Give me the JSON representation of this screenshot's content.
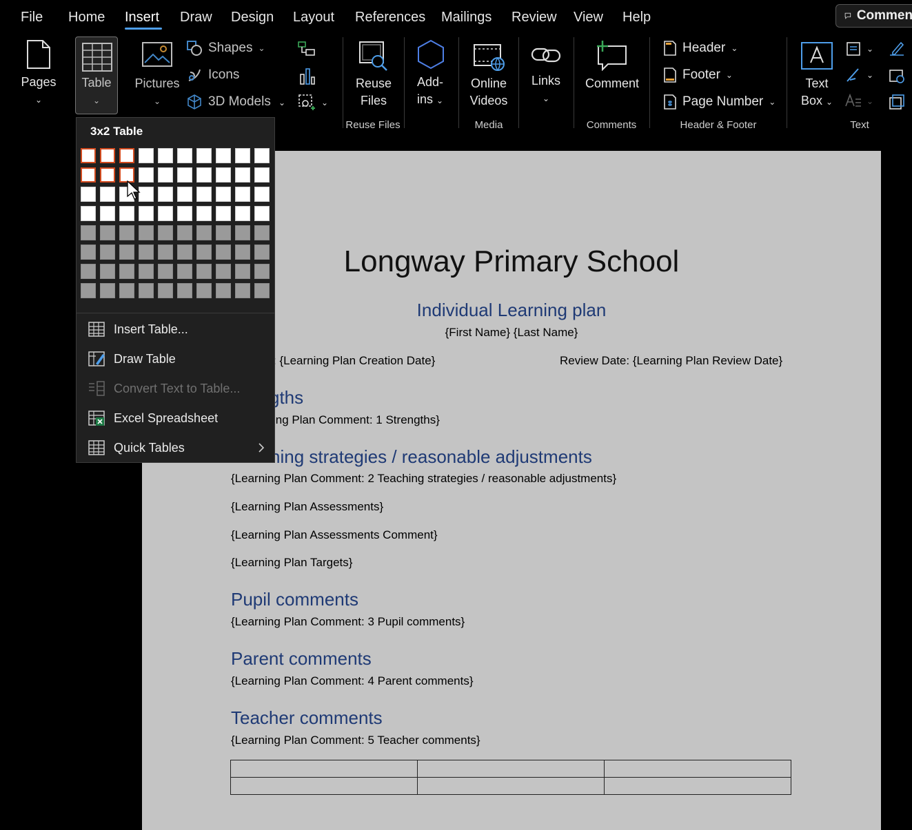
{
  "menubar": {
    "tabs": [
      "File",
      "Home",
      "Insert",
      "Draw",
      "Design",
      "Layout",
      "References",
      "Mailings",
      "Review",
      "View",
      "Help"
    ],
    "active_tab": "Insert",
    "comments_label": "Comments"
  },
  "ribbon": {
    "pages_label": "Pages",
    "table_label": "Table",
    "pictures_label": "Pictures",
    "shapes_label": "Shapes",
    "icons_label": "Icons",
    "models_label": "3D Models",
    "reuse_files_l1": "Reuse",
    "reuse_files_l2": "Files",
    "addins_l1": "Add-",
    "addins_l2": "ins",
    "online_videos_l1": "Online",
    "online_videos_l2": "Videos",
    "links_label": "Links",
    "comment_label": "Comment",
    "header_label": "Header",
    "footer_label": "Footer",
    "page_number_label": "Page Number",
    "textbox_l1": "Text",
    "textbox_l2": "Box",
    "groups": {
      "reuse_files": "Reuse Files",
      "media": "Media",
      "comments": "Comments",
      "header_footer": "Header & Footer",
      "text": "Text"
    }
  },
  "table_dropdown": {
    "title": "3x2 Table",
    "grid_cols": 10,
    "grid_rows": 8,
    "selected_cols": 3,
    "selected_rows": 2,
    "items": [
      {
        "label": "Insert Table...",
        "icon": "insert-table-icon",
        "disabled": false
      },
      {
        "label": "Draw Table",
        "icon": "draw-table-icon",
        "disabled": false
      },
      {
        "label": "Convert Text to Table...",
        "icon": "convert-text-icon",
        "disabled": true
      },
      {
        "label": "Excel Spreadsheet",
        "icon": "excel-icon",
        "disabled": false
      },
      {
        "label": "Quick Tables",
        "icon": "quick-tables-icon",
        "disabled": false
      }
    ]
  },
  "document": {
    "title": "Longway Primary School",
    "subtitle": "Individual Learning plan",
    "name_line": "{First Name} {Last Name}",
    "creation_date": ": {Learning Plan Creation Date}",
    "review_date": "Review Date: {Learning Plan Review Date}",
    "strengths_heading": "gths",
    "strengths_comment": "ing Plan Comment: 1 Strengths}",
    "teaching_heading": "ning strategies / reasonable adjustments",
    "teaching_comment": "{Learning Plan Comment: 2 Teaching strategies / reasonable adjustments}",
    "assessments": "{Learning Plan Assessments}",
    "assessments_comment": "{Learning Plan Assessments Comment}",
    "targets": "{Learning Plan Targets}",
    "pupil_heading": "Pupil comments",
    "pupil_comment": "{Learning Plan Comment: 3 Pupil comments}",
    "parent_heading": "Parent comments",
    "parent_comment": "{Learning Plan Comment: 4 Parent comments}",
    "teacher_heading": "Teacher comments",
    "teacher_comment": "{Learning Plan Comment: 5 Teacher comments}",
    "table_rows": 2,
    "table_cols": 3
  },
  "colors": {
    "accent_underline": "#4e9eea",
    "heading_blue": "#1f3a75",
    "grid_selection": "#d24a1e"
  }
}
